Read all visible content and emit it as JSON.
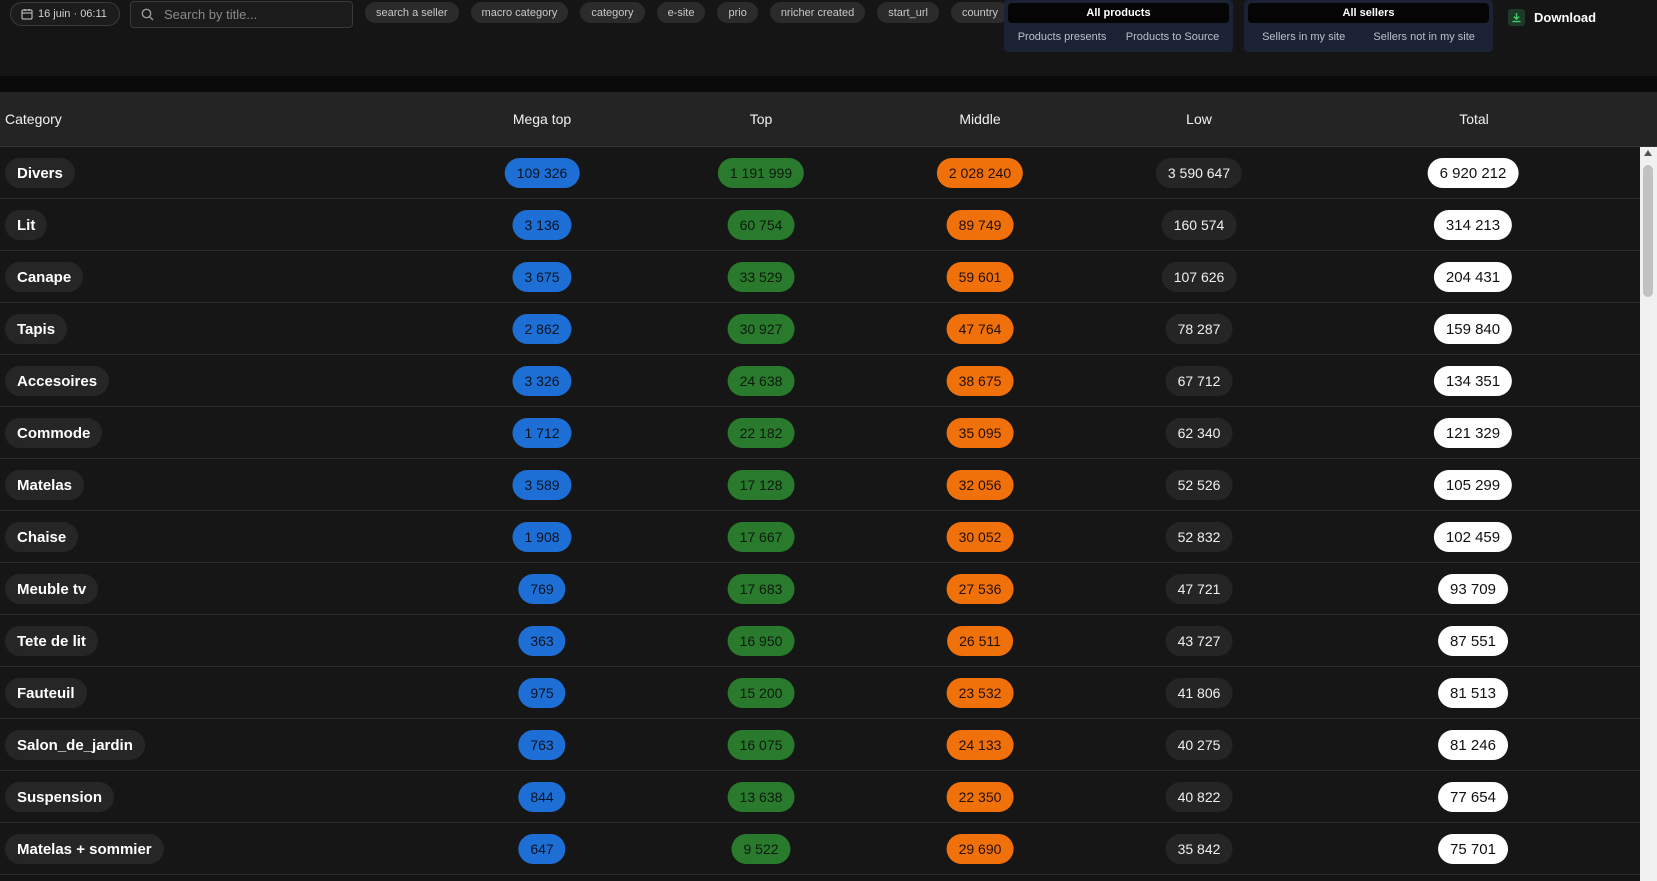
{
  "toolbar": {
    "date": "16 juin · 06:11",
    "search_placeholder": "Search by title...",
    "filters": [
      "search a seller",
      "macro category",
      "category",
      "e-site",
      "prio",
      "nricher created",
      "start_url",
      "country"
    ],
    "products_toggle": {
      "selected": "All products",
      "options": [
        "Products presents",
        "Products to Source"
      ]
    },
    "sellers_toggle": {
      "selected": "All sellers",
      "options": [
        "Sellers in my site",
        "Sellers not in my site"
      ]
    },
    "download_label": "Download"
  },
  "table": {
    "headers": [
      "Category",
      "Mega top",
      "Top",
      "Middle",
      "Low",
      "Total"
    ],
    "rows": [
      {
        "category": "Divers",
        "mega_top": "109 326",
        "top": "1 191 999",
        "middle": "2 028 240",
        "low": "3 590 647",
        "total": "6 920 212"
      },
      {
        "category": "Lit",
        "mega_top": "3 136",
        "top": "60 754",
        "middle": "89 749",
        "low": "160 574",
        "total": "314 213"
      },
      {
        "category": "Canape",
        "mega_top": "3 675",
        "top": "33 529",
        "middle": "59 601",
        "low": "107 626",
        "total": "204 431"
      },
      {
        "category": "Tapis",
        "mega_top": "2 862",
        "top": "30 927",
        "middle": "47 764",
        "low": "78 287",
        "total": "159 840"
      },
      {
        "category": "Accesoires",
        "mega_top": "3 326",
        "top": "24 638",
        "middle": "38 675",
        "low": "67 712",
        "total": "134 351"
      },
      {
        "category": "Commode",
        "mega_top": "1 712",
        "top": "22 182",
        "middle": "35 095",
        "low": "62 340",
        "total": "121 329"
      },
      {
        "category": "Matelas",
        "mega_top": "3 589",
        "top": "17 128",
        "middle": "32 056",
        "low": "52 526",
        "total": "105 299"
      },
      {
        "category": "Chaise",
        "mega_top": "1 908",
        "top": "17 667",
        "middle": "30 052",
        "low": "52 832",
        "total": "102 459"
      },
      {
        "category": "Meuble tv",
        "mega_top": "769",
        "top": "17 683",
        "middle": "27 536",
        "low": "47 721",
        "total": "93 709"
      },
      {
        "category": "Tete de lit",
        "mega_top": "363",
        "top": "16 950",
        "middle": "26 511",
        "low": "43 727",
        "total": "87 551"
      },
      {
        "category": "Fauteuil",
        "mega_top": "975",
        "top": "15 200",
        "middle": "23 532",
        "low": "41 806",
        "total": "81 513"
      },
      {
        "category": "Salon_de_jardin",
        "mega_top": "763",
        "top": "16 075",
        "middle": "24 133",
        "low": "40 275",
        "total": "81 246"
      },
      {
        "category": "Suspension",
        "mega_top": "844",
        "top": "13 638",
        "middle": "22 350",
        "low": "40 822",
        "total": "77 654"
      },
      {
        "category": "Matelas + sommier",
        "mega_top": "647",
        "top": "9 522",
        "middle": "29 690",
        "low": "35 842",
        "total": "75 701"
      }
    ]
  },
  "colors": {
    "mega_top": "#1d6fd6",
    "top": "#2a7a2d",
    "middle": "#f0700a",
    "low": "#252525",
    "total": "#ffffff"
  }
}
